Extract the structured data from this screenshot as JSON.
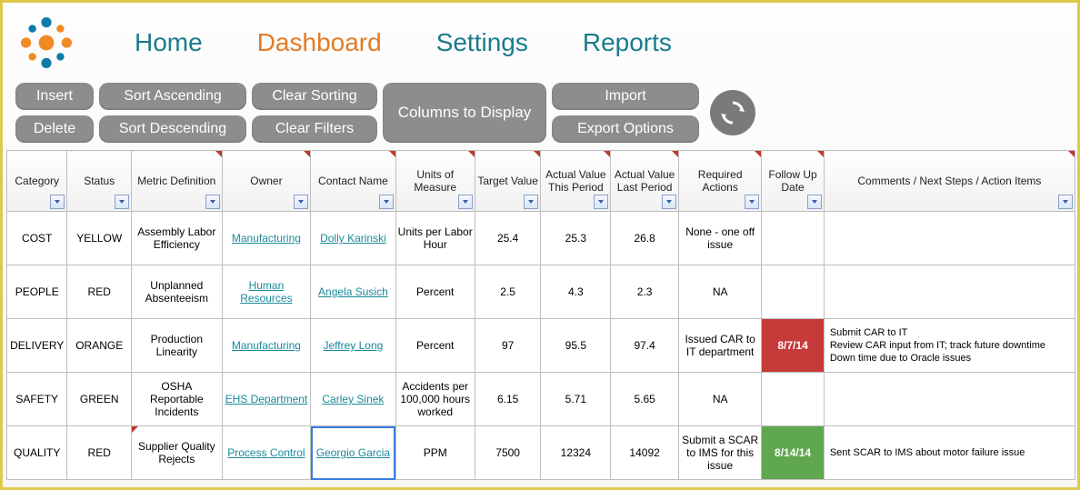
{
  "nav": {
    "home": "Home",
    "dashboard": "Dashboard",
    "settings": "Settings",
    "reports": "Reports"
  },
  "toolbar": {
    "insert": "Insert",
    "delete": "Delete",
    "sort_asc": "Sort Ascending",
    "sort_desc": "Sort Descending",
    "clear_sorting": "Clear Sorting",
    "clear_filters": "Clear Filters",
    "columns": "Columns to Display",
    "import": "Import",
    "export_options": "Export Options"
  },
  "headers": {
    "category": "Category",
    "status": "Status",
    "metric": "Metric Definition",
    "owner": "Owner",
    "contact": "Contact Name",
    "uom": "Units of Measure",
    "target": "Target Value",
    "actual_this": "Actual Value This Period",
    "actual_last": "Actual Value Last Period",
    "required": "Required Actions",
    "follow": "Follow Up Date",
    "comments": "Comments / Next Steps / Action Items"
  },
  "rows": [
    {
      "category": "COST",
      "status": "YELLOW",
      "metric": "Assembly Labor Efficiency",
      "owner": "Manufacturing",
      "contact": "Dolly Karinski",
      "uom": "Units per Labor Hour",
      "target": "25.4",
      "actual_this": "25.3",
      "actual_last": "26.8",
      "required": "None - one off issue",
      "follow": "",
      "follow_flag": "",
      "comments": ""
    },
    {
      "category": "PEOPLE",
      "status": "RED",
      "metric": "Unplanned Absenteeism",
      "owner": "Human Resources",
      "contact": "Angela Susich",
      "uom": "Percent",
      "target": "2.5",
      "actual_this": "4.3",
      "actual_last": "2.3",
      "required": "NA",
      "follow": "",
      "follow_flag": "",
      "comments": ""
    },
    {
      "category": "DELIVERY",
      "status": "ORANGE",
      "metric": "Production Linearity",
      "owner": "Manufacturing",
      "contact": "Jeffrey Long",
      "uom": "Percent",
      "target": "97",
      "actual_this": "95.5",
      "actual_last": "97.4",
      "required": "Issued CAR to IT department",
      "follow": "8/7/14",
      "follow_flag": "red",
      "comments": "Submit CAR to IT\nReview CAR input from IT; track future downtime\nDown time due to Oracle issues"
    },
    {
      "category": "SAFETY",
      "status": "GREEN",
      "metric": "OSHA Reportable Incidents",
      "owner": "EHS Department",
      "contact": "Carley Sinek",
      "uom": "Accidents per 100,000 hours worked",
      "target": "6.15",
      "actual_this": "5.71",
      "actual_last": "5.65",
      "required": "NA",
      "follow": "",
      "follow_flag": "",
      "comments": ""
    },
    {
      "category": "QUALITY",
      "status": "RED",
      "metric": "Supplier Quality Rejects",
      "owner": "Process Control",
      "contact": "Georgio Garcia",
      "uom": "PPM",
      "target": "7500",
      "actual_this": "12324",
      "actual_last": "14092",
      "required": "Submit a SCAR to IMS for this issue",
      "follow": "8/14/14",
      "follow_flag": "green",
      "comments": "Sent SCAR to IMS about motor failure issue"
    }
  ]
}
